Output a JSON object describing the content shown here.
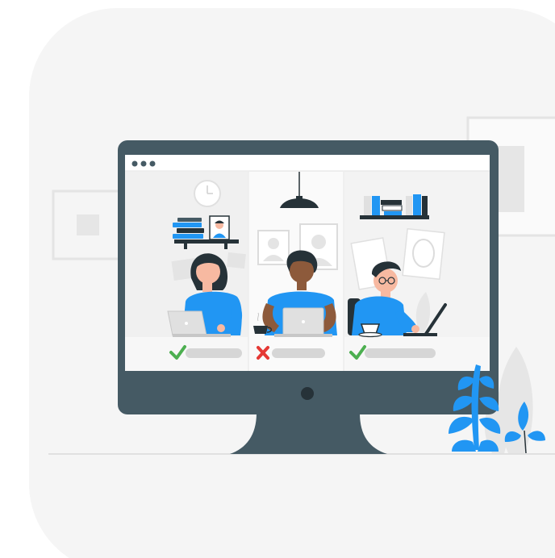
{
  "colors": {
    "background": "#ffffff",
    "card": "#f5f5f5",
    "frame": "#e8e8e8",
    "monitor": "#455a64",
    "screen": "#f7f7f7",
    "accent": "#2196f3",
    "skin_light": "#f7b9a1",
    "skin_dark": "#8d5a3b",
    "hair": "#263238",
    "check_green": "#4caf50",
    "cross_red": "#e53935",
    "status_bar": "#d6d6d6"
  },
  "icons": {
    "check": "check-icon",
    "cross": "cross-icon",
    "window_dots": "window-dots-icon",
    "lamp": "lamp-icon",
    "clock": "clock-icon",
    "coffee": "coffee-cup-icon",
    "laptop": "laptop-icon",
    "plant": "plant-icon"
  },
  "call_participants": [
    {
      "id": "left",
      "status": "approved"
    },
    {
      "id": "middle",
      "status": "rejected"
    },
    {
      "id": "right",
      "status": "approved"
    }
  ]
}
